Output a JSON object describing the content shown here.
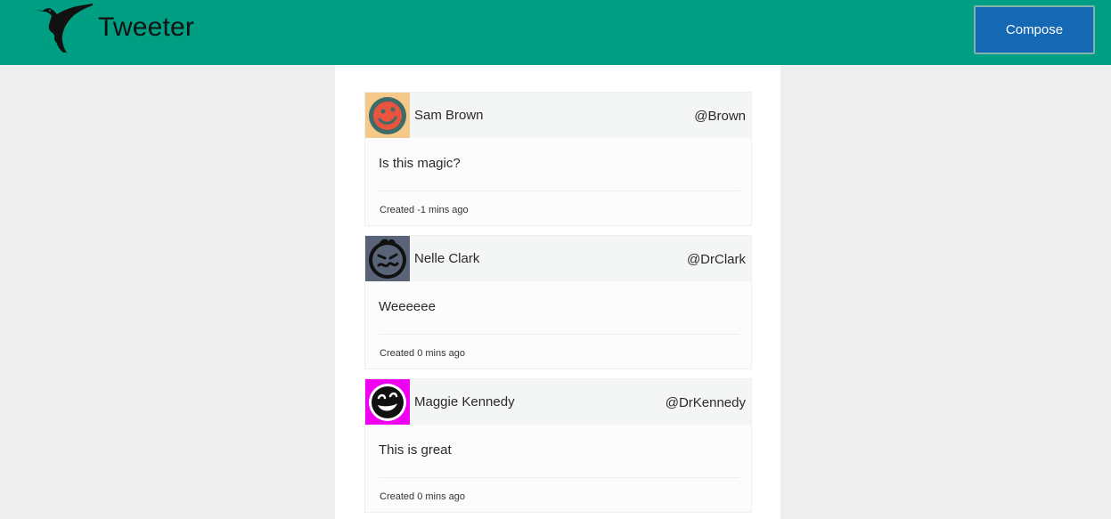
{
  "header": {
    "title": "Tweeter",
    "compose_label": "Compose",
    "logo_icon": "hummingbird-icon",
    "background_color": "#009e82",
    "compose_color": "#1568b4"
  },
  "tweets": [
    {
      "name": "Sam Brown",
      "handle": "@Brown",
      "text": "Is this magic?",
      "created": "Created -1 mins ago",
      "avatar_icon": "smiley-face-icon",
      "avatar_bg": "#f5c98a"
    },
    {
      "name": "Nelle Clark",
      "handle": "@DrClark",
      "text": "Weeeeee",
      "created": "Created 0 mins ago",
      "avatar_icon": "grimace-face-icon",
      "avatar_bg": "#5a6479"
    },
    {
      "name": "Maggie Kennedy",
      "handle": "@DrKennedy",
      "text": "This is great",
      "created": "Created 0 mins ago",
      "avatar_icon": "grin-face-icon",
      "avatar_bg": "#f000f0"
    }
  ]
}
